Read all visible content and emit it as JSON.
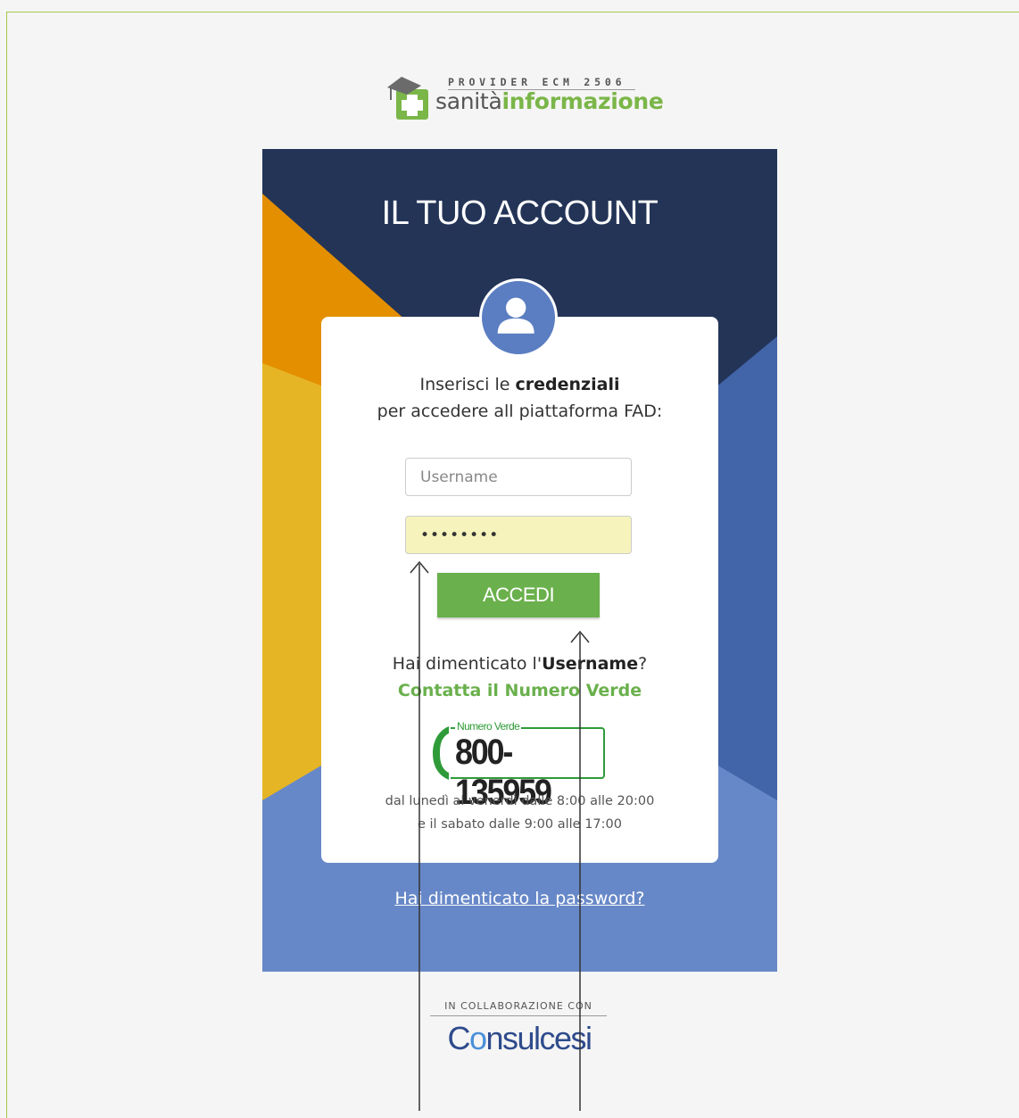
{
  "header": {
    "provider": "PROVIDER ECM 2506",
    "brand_prefix": "sanità",
    "brand_suffix": "informazione"
  },
  "card": {
    "title": "IL TUO ACCOUNT",
    "intro_line1_prefix": "Inserisci le ",
    "intro_line1_bold": "credenziali",
    "intro_line2": "per accedere all piattaforma FAD:",
    "username_placeholder": "Username",
    "password_value": "••••••••",
    "submit_label": "ACCEDI",
    "forgot_user_prefix": "Hai dimenticato l'",
    "forgot_user_bold": "Username",
    "forgot_user_suffix": "?",
    "contact_label": "Contatta il Numero Verde",
    "numero_verde_label": "Numero Verde",
    "numero_verde_number": "800-135959",
    "hours_line1": "dal lunedì al venerdì dalle 8:00 alle 20:00",
    "hours_line2": "e il sabato dalle 9:00 alle 17:00",
    "forgot_password": "Hai dimenticato la password?"
  },
  "footer": {
    "collab_label": "IN COLLABORAZIONE CON",
    "partner_c": "C",
    "partner_o": "o",
    "partner_rest": "nsulcesi"
  },
  "colors": {
    "navy": "#233457",
    "orange": "#e38f00",
    "yellow": "#e5b526",
    "blue_mid": "#4264a8",
    "blue_light": "#6788c8",
    "green": "#6ab04c"
  }
}
